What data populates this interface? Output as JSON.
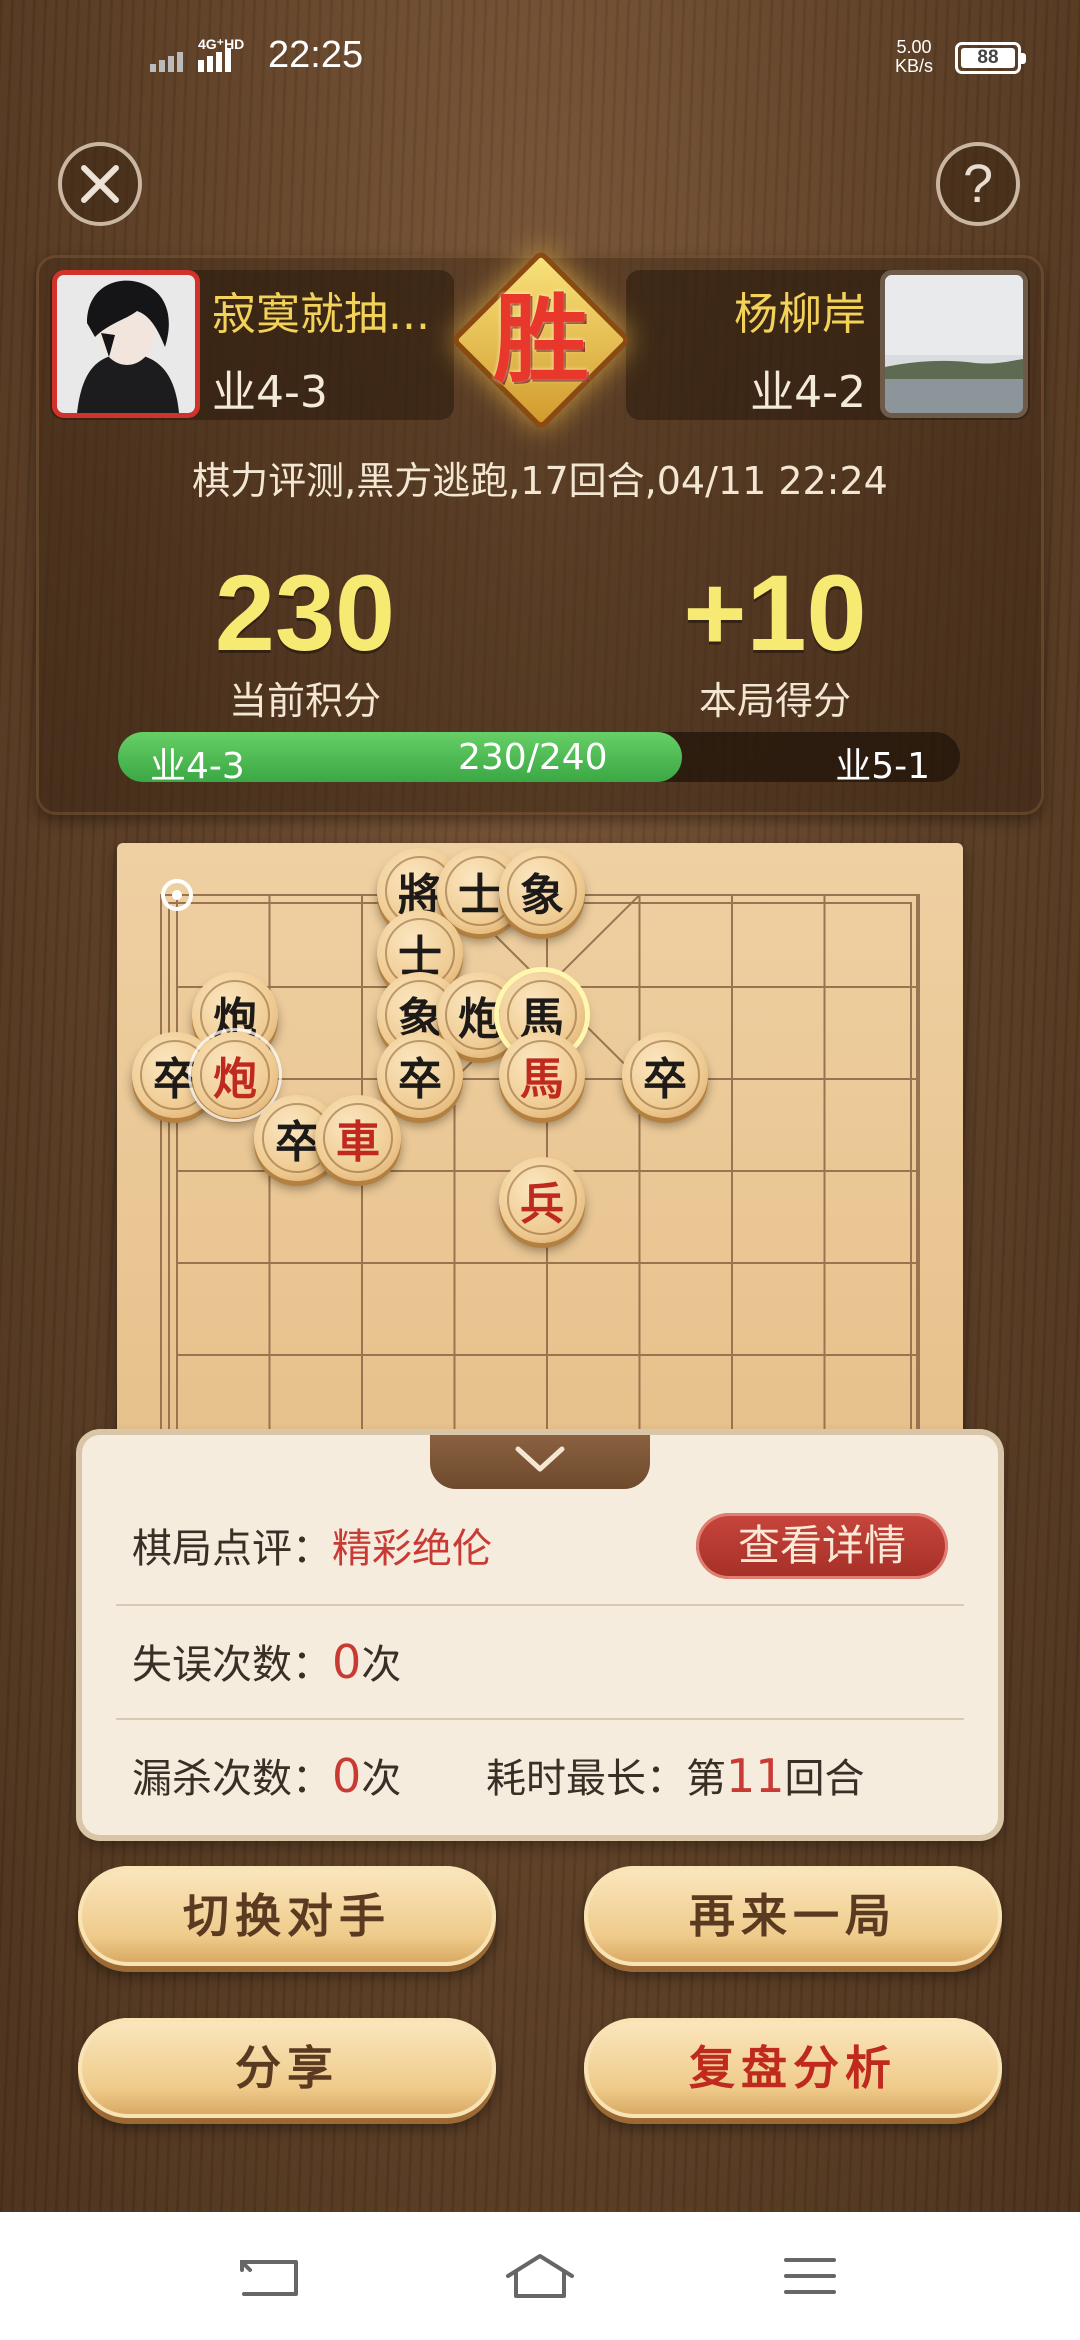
{
  "status_bar": {
    "network": "4G⁺HD",
    "time": "22:25",
    "speed_value": "5.00",
    "speed_unit": "KB/s",
    "battery": "88"
  },
  "header": {
    "close_icon": "close-icon",
    "help_label": "?"
  },
  "players": {
    "left": {
      "name": "寂寞就抽...",
      "rank": "业4-3"
    },
    "right": {
      "name": "杨柳岸",
      "rank": "业4-2"
    },
    "result_badge": "胜"
  },
  "match_info": "棋力评测,黑方逃跑,17回合,04/11  22:24",
  "score": {
    "current_value": "230",
    "current_label": "当前积分",
    "gain_value": "+10",
    "gain_label": "本局得分"
  },
  "progress": {
    "from_rank": "业4-3",
    "text": "230/240",
    "to_rank": "业5-1",
    "fraction": 0.67
  },
  "board": {
    "pieces": [
      {
        "char": "將",
        "side": "black"
      },
      {
        "char": "士",
        "side": "black"
      },
      {
        "char": "象",
        "side": "black"
      },
      {
        "char": "士",
        "side": "black"
      },
      {
        "char": "炮",
        "side": "black"
      },
      {
        "char": "象",
        "side": "black"
      },
      {
        "char": "炮",
        "side": "black"
      },
      {
        "char": "馬",
        "side": "black"
      },
      {
        "char": "卒",
        "side": "black"
      },
      {
        "char": "炮",
        "side": "red"
      },
      {
        "char": "卒",
        "side": "black"
      },
      {
        "char": "馬",
        "side": "red"
      },
      {
        "char": "卒",
        "side": "black"
      },
      {
        "char": "卒",
        "side": "black"
      },
      {
        "char": "車",
        "side": "red"
      },
      {
        "char": "兵",
        "side": "red"
      }
    ]
  },
  "review": {
    "comment_label": "棋局点评：",
    "comment_value": "精彩绝伦",
    "detail_button": "查看详情",
    "mistakes_label": "失误次数：",
    "mistakes_value": "0",
    "mistakes_unit": "次",
    "missed_label": "漏杀次数：",
    "missed_value": "0",
    "missed_unit": "次",
    "longest_label": "耗时最长：",
    "longest_prefix": "第",
    "longest_value": "11",
    "longest_suffix": "回合"
  },
  "actions": {
    "switch_opponent": "切换对手",
    "play_again": "再来一局",
    "share": "分享",
    "replay_analysis": "复盘分析"
  },
  "colors": {
    "accent_gold": "#f6ea73",
    "red": "#c93a34",
    "progress_green": "#3aa844"
  }
}
